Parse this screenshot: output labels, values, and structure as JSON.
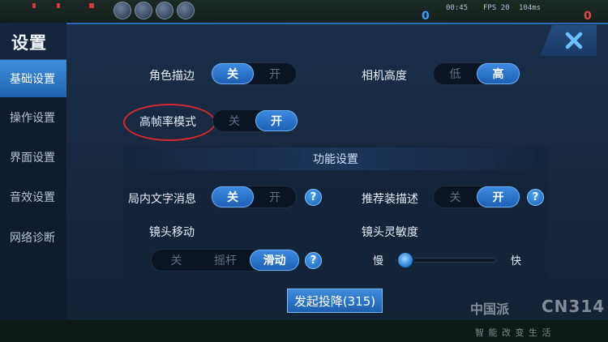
{
  "hud": {
    "time": "00:45",
    "fps": "FPS 20",
    "ping": "104ms",
    "score_left": "0",
    "score_right": "0"
  },
  "dialog": {
    "title": "设置",
    "close_icon": "close-x-icon"
  },
  "sidebar": {
    "items": [
      {
        "label": "基础设置",
        "active": true
      },
      {
        "label": "操作设置",
        "active": false
      },
      {
        "label": "界面设置",
        "active": false
      },
      {
        "label": "音效设置",
        "active": false
      },
      {
        "label": "网络诊断",
        "active": false
      }
    ]
  },
  "settings": {
    "outline": {
      "label": "角色描边",
      "off": "关",
      "on": "开",
      "selected": "关"
    },
    "camera_height": {
      "label": "相机高度",
      "low": "低",
      "high": "高",
      "selected": "高"
    },
    "high_fps": {
      "label": "高帧率模式",
      "off": "关",
      "on": "开",
      "selected": "开"
    }
  },
  "section": {
    "title": "功能设置",
    "in_game_text": {
      "label": "局内文字消息",
      "off": "关",
      "on": "开",
      "selected": "关",
      "help": "?"
    },
    "recommend_desc": {
      "label": "推荐装描述",
      "off": "关",
      "on": "开",
      "selected": "开",
      "help": "?"
    },
    "camera_move": {
      "label": "镜头移动",
      "opt1": "关",
      "opt2": "摇杆",
      "opt3": "滑动",
      "selected": "滑动",
      "help": "?"
    },
    "camera_sensitivity": {
      "label": "镜头灵敏度",
      "slow": "慢",
      "fast": "快",
      "value": 0.1
    }
  },
  "surrender_button": "发起投降(315)",
  "watermark": {
    "brand": "中国派",
    "code": "CN314",
    "slogan": "智 能 改 变 生 活"
  },
  "colors": {
    "accent": "#2f78cc",
    "highlight_circle": "#d8282d",
    "panel": "#16263c"
  }
}
